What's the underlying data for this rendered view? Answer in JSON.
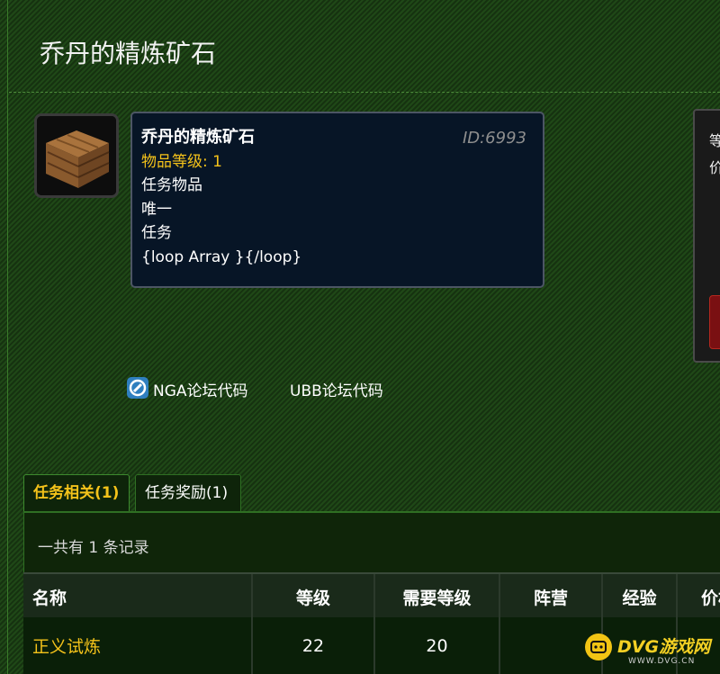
{
  "page": {
    "title": "乔丹的精炼矿石"
  },
  "tooltip": {
    "name": "乔丹的精炼矿石",
    "id_label": "ID:6993",
    "item_level": "物品等级: 1",
    "lines": [
      "任务物品",
      "唯一",
      "任务",
      "{loop Array }{/loop}"
    ]
  },
  "right_panel": {
    "line1": "等",
    "line2": "价"
  },
  "codes": {
    "nga": "NGA论坛代码",
    "ubb": "UBB论坛代码"
  },
  "tabs": [
    {
      "label": "任务相关(1)",
      "active": true
    },
    {
      "label": "任务奖励(1)",
      "active": false
    }
  ],
  "record_count": "一共有 1 条记录",
  "table": {
    "headers": [
      "名称",
      "等级",
      "需要等级",
      "阵营",
      "经验",
      "价格"
    ],
    "rows": [
      {
        "name": "正义试炼",
        "level": "22",
        "req_level": "20",
        "faction": "",
        "exp": "",
        "price": ""
      }
    ]
  },
  "watermark": {
    "text": "DVG游戏网",
    "url": "WWW.DVG.CN"
  },
  "colors": {
    "accent_gold": "#f4c21a",
    "tooltip_bg": "#071526",
    "page_bg": "#1a3a12"
  }
}
